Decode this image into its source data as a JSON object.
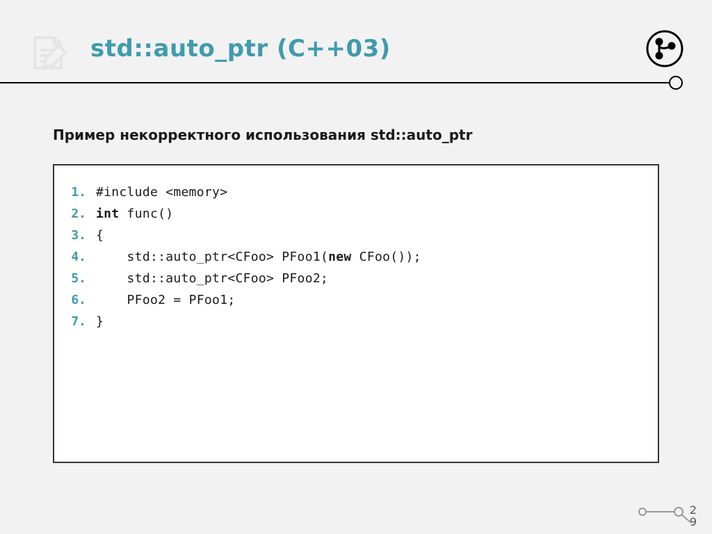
{
  "header": {
    "title": "std::auto_ptr (C++03)"
  },
  "subtitle": "Пример некорректного использования std::auto_ptr",
  "code": {
    "lines": [
      {
        "n": "1.",
        "pre": "#include <memory>",
        "kw": "",
        "post": ""
      },
      {
        "n": "2.",
        "pre": "",
        "kw": "int",
        "post": " func()"
      },
      {
        "n": "3.",
        "pre": "{",
        "kw": "",
        "post": ""
      },
      {
        "n": "4.",
        "pre": "    std::auto_ptr<CFoo> PFoo1(",
        "kw": "new",
        "post": " CFoo());"
      },
      {
        "n": "5.",
        "pre": "    std::auto_ptr<CFoo> PFoo2;",
        "kw": "",
        "post": ""
      },
      {
        "n": "6.",
        "pre": "    PFoo2 = PFoo1;",
        "kw": "",
        "post": ""
      },
      {
        "n": "7.",
        "pre": "}",
        "kw": "",
        "post": ""
      }
    ]
  },
  "page": {
    "d1": "2",
    "d2": "9"
  }
}
